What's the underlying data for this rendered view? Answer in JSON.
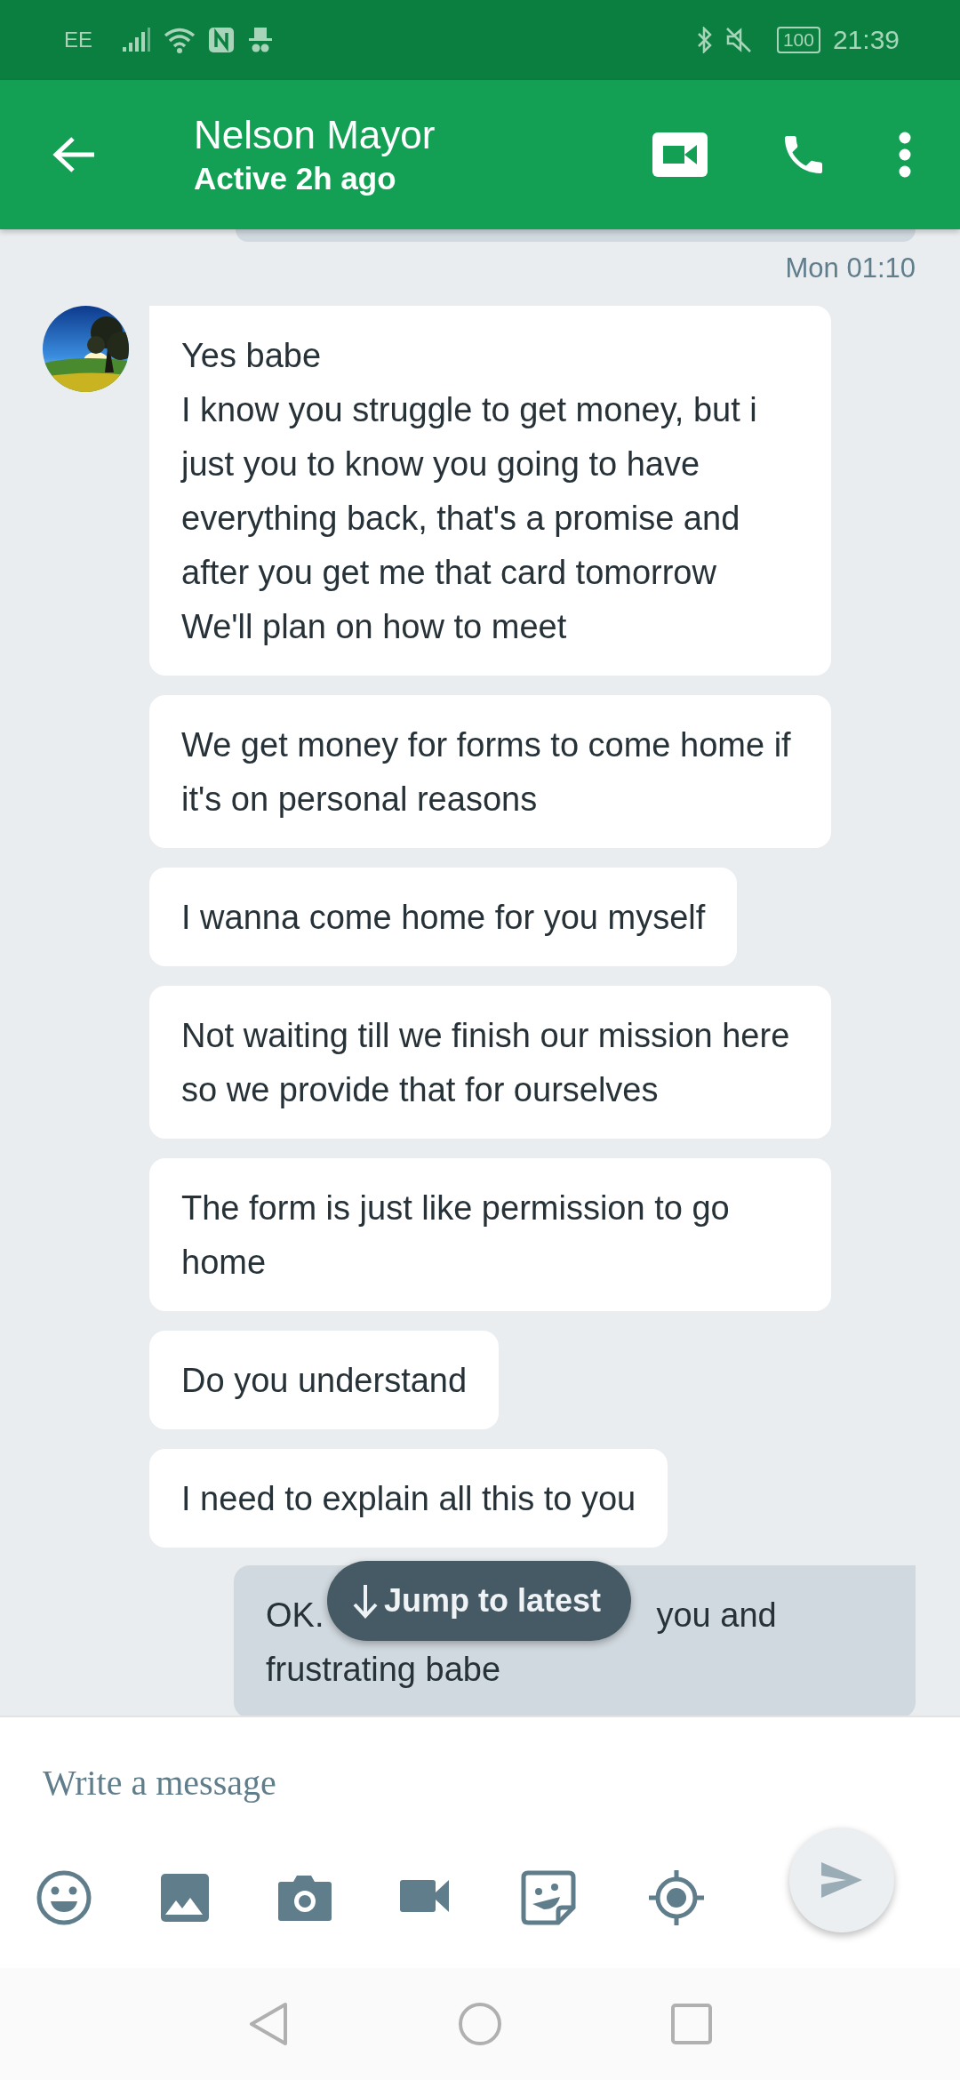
{
  "status_bar": {
    "carrier": "EE",
    "battery": "100",
    "time": "21:39"
  },
  "header": {
    "name": "Nelson Mayor",
    "status": "Active 2h ago"
  },
  "timestamp": "Mon 01:10",
  "messages": [
    {
      "kind": "incoming",
      "avatar": true,
      "text": "Yes babe\nI know you struggle to get money, but i just you to know you going to have everything back, that's a promise and after you get me that card tomorrow\nWe'll plan on how to meet"
    },
    {
      "kind": "incoming",
      "avatar": false,
      "text": "We get money for forms to come home if it's on personal reasons"
    },
    {
      "kind": "incoming",
      "avatar": false,
      "text": "I wanna come home for you myself"
    },
    {
      "kind": "incoming",
      "avatar": false,
      "text": "Not waiting till we finish our mission here so we provide that for ourselves"
    },
    {
      "kind": "incoming",
      "avatar": false,
      "text": "The form is just like permission to go home"
    },
    {
      "kind": "incoming",
      "avatar": false,
      "text": "Do you understand"
    },
    {
      "kind": "incoming",
      "avatar": false,
      "text": "I need to explain all this to you"
    },
    {
      "kind": "outgoing",
      "text_left": "OK.",
      "text_right": "you and",
      "text": "frustrating babe"
    }
  ],
  "jump_button": "Jump to latest",
  "composer": {
    "placeholder": "Write a message"
  }
}
